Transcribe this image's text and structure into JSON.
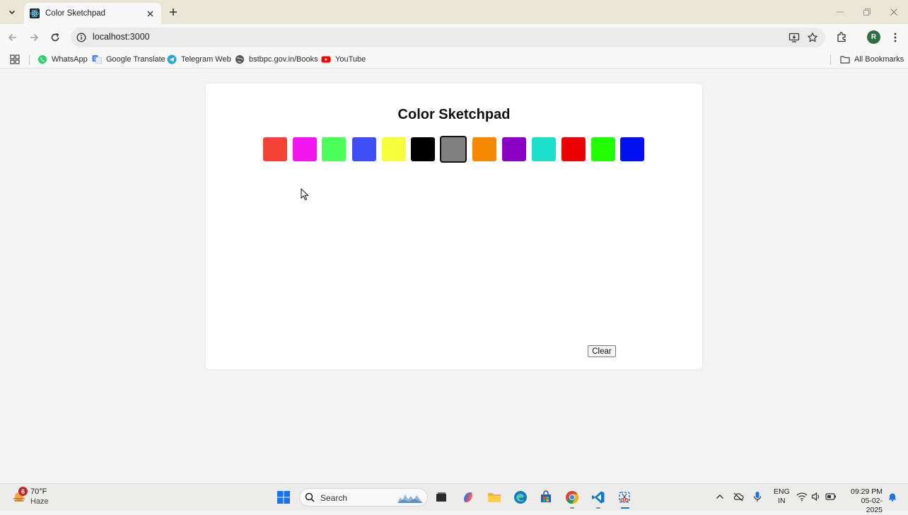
{
  "browser": {
    "tab_title": "Color Sketchpad",
    "url": "localhost:3000",
    "avatar_letter": "R",
    "bookmarks": [
      "WhatsApp",
      "Google Translate",
      "Telegram Web",
      "bstbpc.gov.in/Books",
      "YouTube"
    ],
    "all_bookmarks": "All Bookmarks"
  },
  "page": {
    "title": "Color Sketchpad",
    "clear_label": "Clear",
    "swatches": [
      {
        "color": "#f44336",
        "selected": false
      },
      {
        "color": "#f216f0",
        "selected": false
      },
      {
        "color": "#4dff5a",
        "selected": false
      },
      {
        "color": "#3d4ff5",
        "selected": false
      },
      {
        "color": "#f5ff3a",
        "selected": false
      },
      {
        "color": "#000000",
        "selected": false
      },
      {
        "color": "#808080",
        "selected": true
      },
      {
        "color": "#f58a00",
        "selected": false
      },
      {
        "color": "#8a00c4",
        "selected": false
      },
      {
        "color": "#1de0cc",
        "selected": false
      },
      {
        "color": "#ee0000",
        "selected": false
      },
      {
        "color": "#22ff00",
        "selected": false
      },
      {
        "color": "#0010f0",
        "selected": false
      }
    ]
  },
  "taskbar": {
    "weather_badge": "6",
    "temperature": "70°F",
    "condition": "Haze",
    "search_label": "Search",
    "lang_line1": "ENG",
    "lang_line2": "IN",
    "time": "09:29 PM",
    "date": "05-02-2025"
  }
}
